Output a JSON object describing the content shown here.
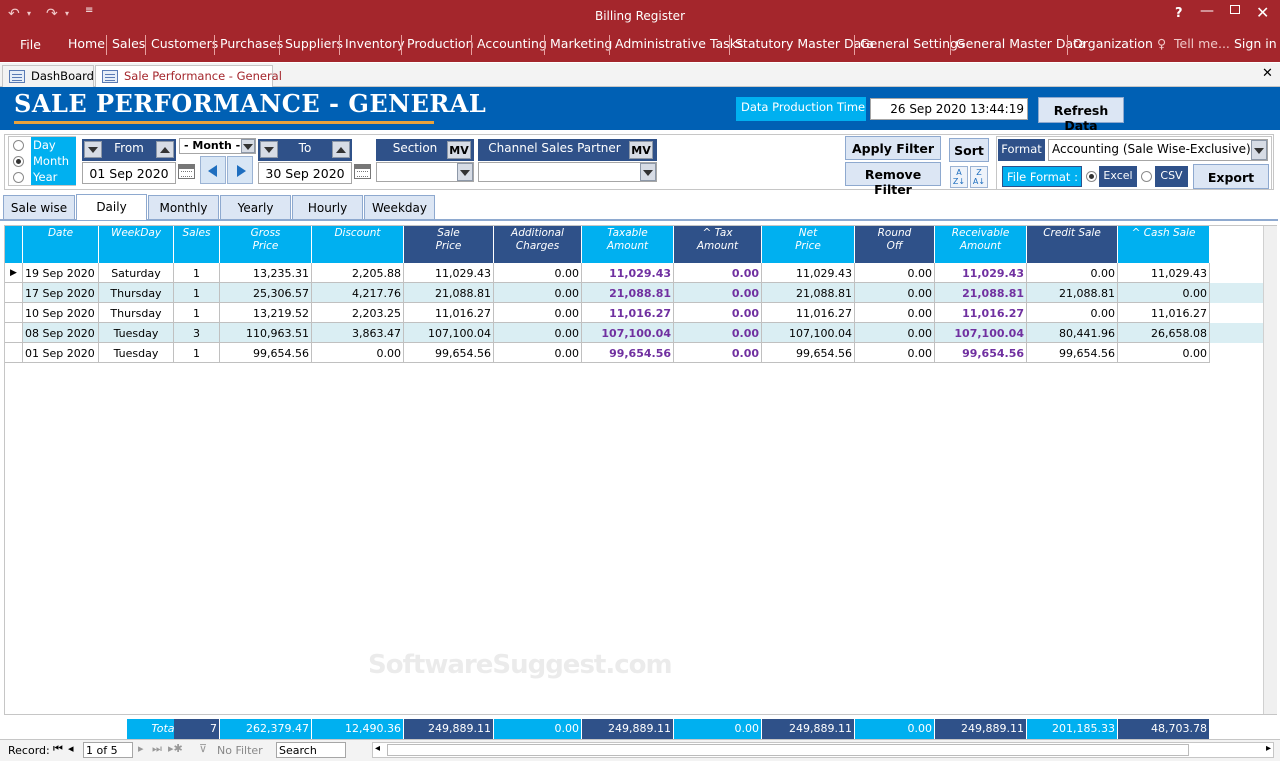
{
  "window": {
    "title": "Billing Register",
    "help": "?"
  },
  "ribbon": {
    "file": "File",
    "menus": [
      "Home",
      "Sales",
      "Customers",
      "Purchases",
      "Suppliers",
      "Inventory",
      "Production",
      "Accounting",
      "Marketing",
      "Administrative Tasks",
      "Statutory Master Data",
      "General Settings",
      "General Master Data",
      "Organization"
    ],
    "tell_me": "Tell me...",
    "sign_in": "Sign in"
  },
  "doc_tabs": [
    "DashBoard",
    "Sale Performance - General"
  ],
  "header": {
    "title": "SALE PERFORMANCE - GENERAL",
    "data_time_label": "Data Production Time",
    "data_time_value": "26 Sep 2020 13:44:19",
    "refresh_label": "Refresh Data"
  },
  "filters": {
    "period_options": [
      "Day",
      "Month",
      "Year"
    ],
    "period_selected": "Month",
    "from_label": "From",
    "from_value": "01 Sep 2020",
    "month_select": "- Month -",
    "to_label": "To",
    "to_value": "30 Sep 2020",
    "section_label": "Section",
    "mv": "MV",
    "section_value": "",
    "channel_label": "Channel Sales Partner",
    "channel_value": "",
    "apply_label": "Apply Filter",
    "remove_label": "Remove Filter",
    "sort_label": "Sort",
    "format_label": "Format",
    "format_value": "Accounting (Sale Wise-Exclusive)",
    "file_format_label": "File Format :",
    "file_options": [
      "Excel",
      "CSV"
    ],
    "file_selected": "Excel",
    "export_label": "Export"
  },
  "view_tabs": [
    "Sale wise",
    "Daily",
    "Monthly",
    "Yearly",
    "Hourly",
    "Weekday"
  ],
  "view_tab_active": "Daily",
  "table": {
    "columns": [
      {
        "key": "date",
        "label": "Date"
      },
      {
        "key": "weekday",
        "label": "WeekDay"
      },
      {
        "key": "sales",
        "label": "Sales"
      },
      {
        "key": "gross",
        "label": "Gross\nPrice"
      },
      {
        "key": "discount",
        "label": "Discount"
      },
      {
        "key": "sale_price",
        "label": "Sale\nPrice"
      },
      {
        "key": "add_charges",
        "label": "Additional\nCharges"
      },
      {
        "key": "taxable",
        "label": "Taxable\nAmount"
      },
      {
        "key": "tax",
        "label": "^ Tax\nAmount"
      },
      {
        "key": "net",
        "label": "Net\nPrice"
      },
      {
        "key": "round",
        "label": "Round\nOff"
      },
      {
        "key": "receivable",
        "label": "Receivable\nAmount"
      },
      {
        "key": "credit",
        "label": "Credit Sale"
      },
      {
        "key": "cash",
        "label": "^ Cash Sale"
      }
    ],
    "rows": [
      [
        "19 Sep 2020",
        "Saturday",
        "1",
        "13,235.31",
        "2,205.88",
        "11,029.43",
        "0.00",
        "11,029.43",
        "0.00",
        "11,029.43",
        "0.00",
        "11,029.43",
        "0.00",
        "11,029.43"
      ],
      [
        "17 Sep 2020",
        "Thursday",
        "1",
        "25,306.57",
        "4,217.76",
        "21,088.81",
        "0.00",
        "21,088.81",
        "0.00",
        "21,088.81",
        "0.00",
        "21,088.81",
        "21,088.81",
        "0.00"
      ],
      [
        "10 Sep 2020",
        "Thursday",
        "1",
        "13,219.52",
        "2,203.25",
        "11,016.27",
        "0.00",
        "11,016.27",
        "0.00",
        "11,016.27",
        "0.00",
        "11,016.27",
        "0.00",
        "11,016.27"
      ],
      [
        "08 Sep 2020",
        "Tuesday",
        "3",
        "110,963.51",
        "3,863.47",
        "107,100.04",
        "0.00",
        "107,100.04",
        "0.00",
        "107,100.04",
        "0.00",
        "107,100.04",
        "80,441.96",
        "26,658.08"
      ],
      [
        "01 Sep 2020",
        "Tuesday",
        "1",
        "99,654.56",
        "0.00",
        "99,654.56",
        "0.00",
        "99,654.56",
        "0.00",
        "99,654.56",
        "0.00",
        "99,654.56",
        "99,654.56",
        "0.00"
      ]
    ],
    "total_label": "Total",
    "totals": [
      "7",
      "262,379.47",
      "12,490.36",
      "249,889.11",
      "0.00",
      "249,889.11",
      "0.00",
      "249,889.11",
      "0.00",
      "249,889.11",
      "201,185.33",
      "48,703.78"
    ]
  },
  "record_bar": {
    "label": "Record:",
    "position": "1 of 5",
    "filter": "No Filter",
    "search": "Search"
  },
  "watermark": {
    "main": "SoftwareSuggest",
    "suffix": ".com"
  },
  "colors": {
    "titlebar": "#a4262c",
    "header": "#0060b4",
    "cyan": "#00b0f0",
    "dark_blue": "#2f5189",
    "purple": "#7030a0"
  }
}
